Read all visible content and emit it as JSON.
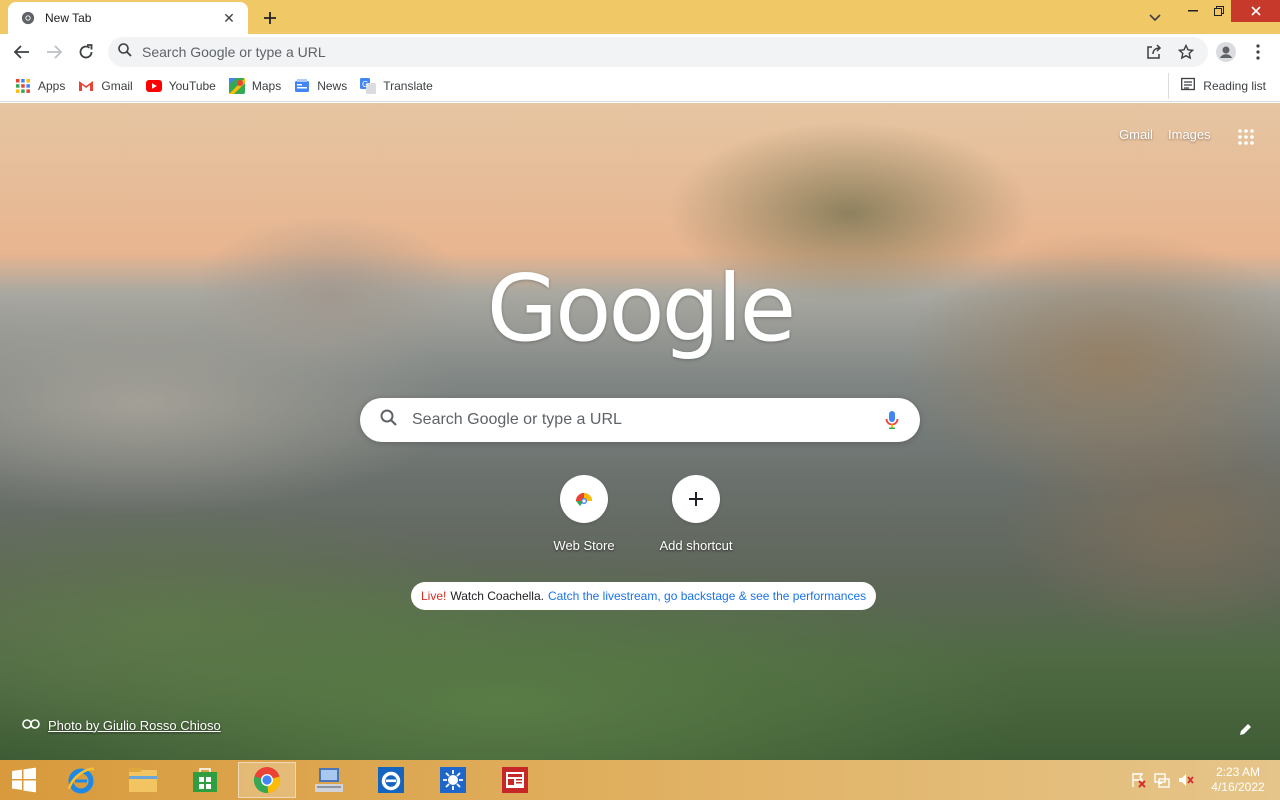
{
  "tab": {
    "title": "New Tab",
    "close": "✕",
    "new_tab": "+"
  },
  "toolbar": {
    "omnibox_placeholder": "Search Google or type a URL"
  },
  "bookmarks": [
    {
      "label": "Apps"
    },
    {
      "label": "Gmail"
    },
    {
      "label": "YouTube"
    },
    {
      "label": "Maps"
    },
    {
      "label": "News"
    },
    {
      "label": "Translate"
    }
  ],
  "reading_list": "Reading list",
  "ntp": {
    "gmail": "Gmail",
    "images": "Images",
    "logo": "Google",
    "search_placeholder": "Search Google or type a URL",
    "shortcuts": [
      {
        "label": "Web Store"
      },
      {
        "label": "Add shortcut"
      }
    ],
    "promo": {
      "live": "Live!",
      "text": "Watch Coachella.",
      "link": "Catch the livestream, go backstage & see the performances"
    },
    "attribution": "Photo by Giulio Rosso Chioso"
  },
  "taskbar": {
    "time": "2:23 AM",
    "date": "4/16/2022"
  },
  "colors": {
    "tab_strip": "#f0c866",
    "close_button": "#c7392b",
    "google_blue": "#4285f4",
    "google_red": "#ea4335",
    "google_yellow": "#fbbc05",
    "google_green": "#34a853",
    "promo_live": "#d93025",
    "promo_link": "#1a73e8"
  }
}
